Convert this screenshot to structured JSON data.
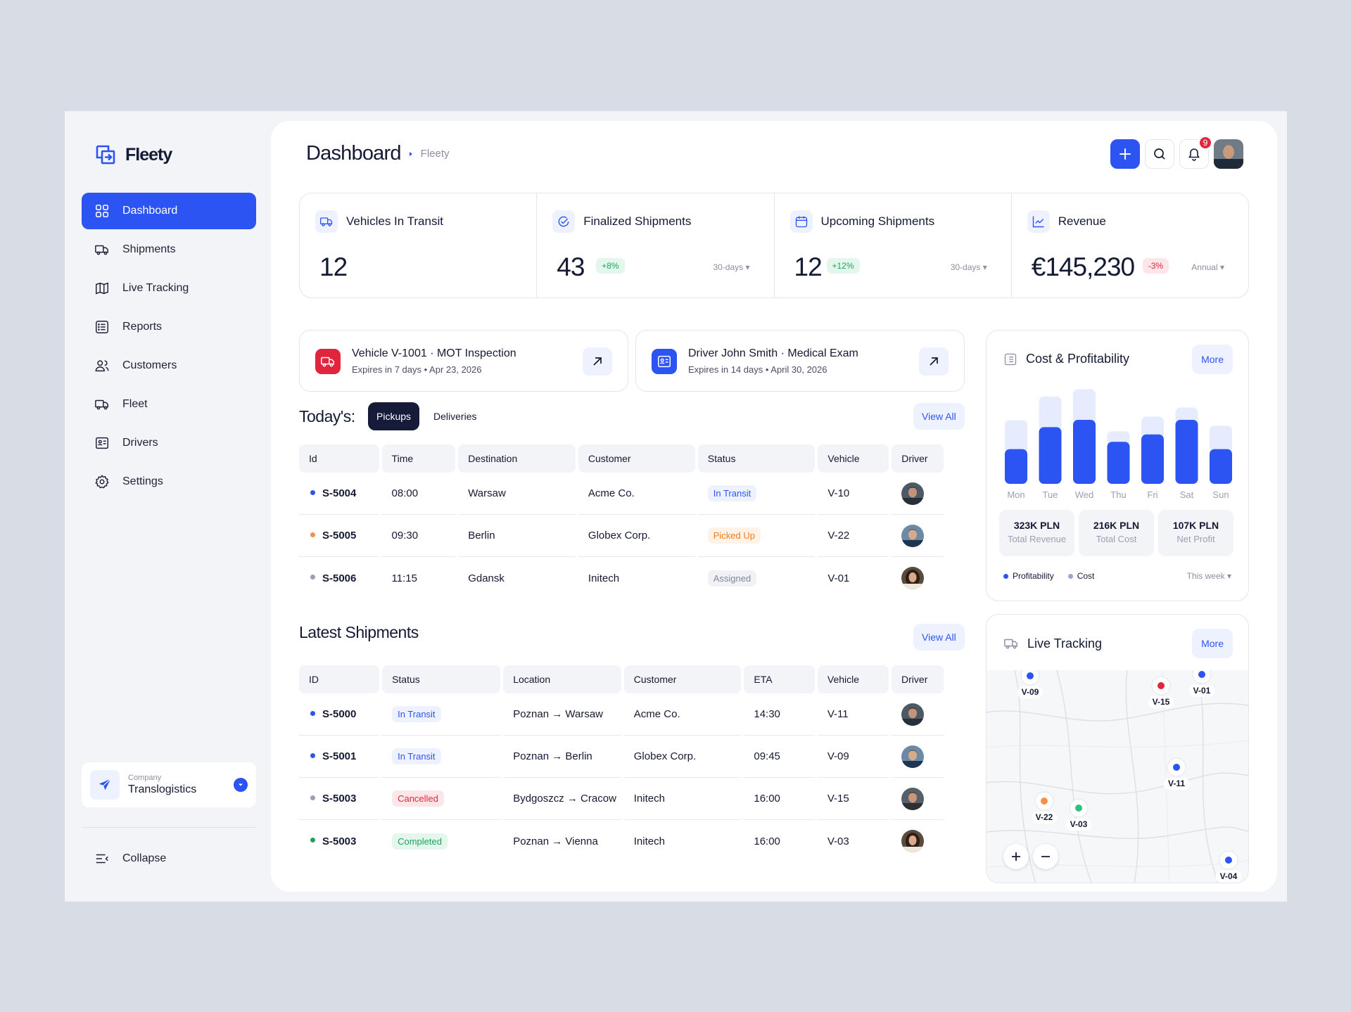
{
  "app": {
    "name": "Fleety"
  },
  "sidebar": {
    "items": [
      {
        "label": "Dashboard",
        "icon": "grid-icon"
      },
      {
        "label": "Shipments",
        "icon": "truck-icon"
      },
      {
        "label": "Live Tracking",
        "icon": "map-icon"
      },
      {
        "label": "Reports",
        "icon": "list-icon"
      },
      {
        "label": "Customers",
        "icon": "users-icon"
      },
      {
        "label": "Fleet",
        "icon": "truck-icon"
      },
      {
        "label": "Drivers",
        "icon": "id-card-icon"
      },
      {
        "label": "Settings",
        "icon": "gear-icon"
      }
    ],
    "company_label": "Company",
    "company_name": "Translogistics",
    "collapse_label": "Collapse"
  },
  "header": {
    "title": "Dashboard",
    "breadcrumb": "Fleety",
    "notifications": "9"
  },
  "stats": [
    {
      "label": "Vehicles In Transit",
      "value": "12"
    },
    {
      "label": "Finalized Shipments",
      "value": "43",
      "change": "+8%",
      "period": "30-days ▾"
    },
    {
      "label": "Upcoming Shipments",
      "value": "12",
      "change": "+12%",
      "period": "30-days ▾"
    },
    {
      "label": "Revenue",
      "value": "€145,230",
      "change": "-3%",
      "period": "Annual ▾"
    }
  ],
  "alerts": [
    {
      "title": "Vehicle V-1001 · MOT Inspection",
      "sub": "Expires in 7 days • Apr 23, 2026"
    },
    {
      "title": "Driver John Smith · Medical Exam",
      "sub": "Expires in 14 days • April 30, 2026"
    }
  ],
  "today": {
    "title": "Today's:",
    "tabs": [
      "Pickups",
      "Deliveries"
    ],
    "view_all": "View All",
    "columns": [
      "Id",
      "Time",
      "Destination",
      "Customer",
      "Status",
      "Vehicle",
      "Driver"
    ],
    "rows": [
      {
        "id": "S-5004",
        "time": "08:00",
        "dest": "Warsaw",
        "customer": "Acme Co.",
        "status": "In Transit",
        "vehicle": "V-10"
      },
      {
        "id": "S-5005",
        "time": "09:30",
        "dest": "Berlin",
        "customer": "Globex Corp.",
        "status": "Picked Up",
        "vehicle": "V-22"
      },
      {
        "id": "S-5006",
        "time": "11:15",
        "dest": "Gdansk",
        "customer": "Initech",
        "status": "Assigned",
        "vehicle": "V-01"
      }
    ]
  },
  "latest": {
    "title": "Latest Shipments",
    "view_all": "View All",
    "columns": [
      "ID",
      "Status",
      "Location",
      "Customer",
      "ETA",
      "Vehicle",
      "Driver"
    ],
    "rows": [
      {
        "id": "S-5000",
        "status": "In Transit",
        "location": "Poznan → Warsaw",
        "customer": "Acme Co.",
        "eta": "14:30",
        "vehicle": "V-11"
      },
      {
        "id": "S-5001",
        "status": "In Transit",
        "location": "Poznan  → Berlin",
        "customer": "Globex Corp.",
        "eta": "09:45",
        "vehicle": "V-09"
      },
      {
        "id": "S-5003",
        "status": "Cancelled",
        "location": "Bydgoszcz → Cracow",
        "customer": "Initech",
        "eta": "16:00",
        "vehicle": "V-15"
      },
      {
        "id": "S-5003",
        "status": "Completed",
        "location": "Poznan → Vienna",
        "customer": "Initech",
        "eta": "16:00",
        "vehicle": "V-03"
      }
    ]
  },
  "cost": {
    "title": "Cost & Profitability",
    "more": "More",
    "kpis": [
      {
        "value": "323K PLN",
        "label": "Total Revenue"
      },
      {
        "value": "216K PLN",
        "label": "Total Cost"
      },
      {
        "value": "107K PLN",
        "label": "Net Profit"
      }
    ],
    "legend": [
      "Profitability",
      "Cost"
    ],
    "period": "This week ▾"
  },
  "chart_data": {
    "type": "bar",
    "categories": [
      "Mon",
      "Tue",
      "Wed",
      "Thu",
      "Fri",
      "Sat",
      "Sun"
    ],
    "series": [
      {
        "name": "Profitability",
        "values": [
          38,
          62,
          70,
          46,
          54,
          70,
          38
        ]
      },
      {
        "name": "Cost",
        "values": [
          30,
          32,
          32,
          10,
          18,
          12,
          24
        ]
      }
    ]
  },
  "tracking": {
    "title": "Live Tracking",
    "more": "More",
    "markers": [
      {
        "label": "V-09",
        "color": "#2c54f2"
      },
      {
        "label": "V-15",
        "color": "#e1253c"
      },
      {
        "label": "V-01",
        "color": "#2c54f2"
      },
      {
        "label": "V-11",
        "color": "#2c54f2"
      },
      {
        "label": "V-22",
        "color": "#f49048"
      },
      {
        "label": "V-03",
        "color": "#2ec27e"
      },
      {
        "label": "V-04",
        "color": "#2c54f2"
      }
    ]
  },
  "colors": {
    "accent": "#2c54f2",
    "dark": "#151b38"
  }
}
